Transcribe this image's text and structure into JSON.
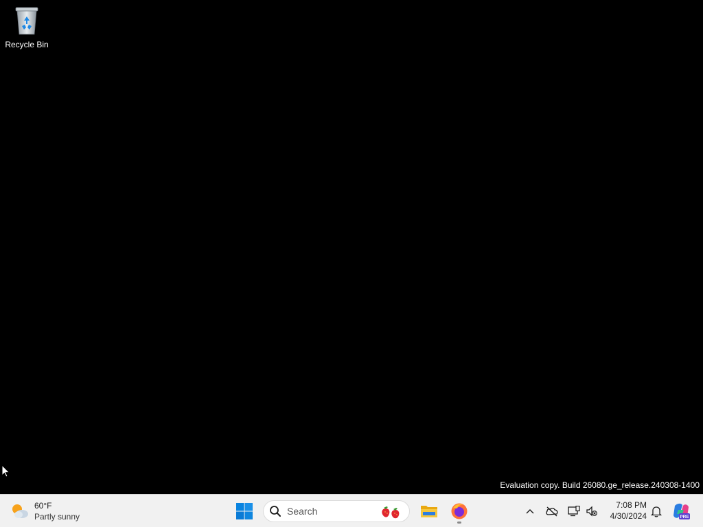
{
  "desktop": {
    "icons": [
      {
        "label": "Recycle Bin",
        "icon": "recycle-bin-icon"
      }
    ],
    "watermark": "Evaluation copy. Build 26080.ge_release.240308-1400",
    "background": "#000000"
  },
  "taskbar": {
    "weather": {
      "temp": "60°F",
      "condition": "Partly sunny",
      "icon": "partly-sunny-icon"
    },
    "start": {
      "icon": "windows-start-icon"
    },
    "search": {
      "placeholder": "Search",
      "icon": "search-icon",
      "decoration": "strawberry-icon"
    },
    "apps": [
      {
        "name": "File Explorer",
        "icon": "folder-icon",
        "running": false
      },
      {
        "name": "Firefox",
        "icon": "firefox-icon",
        "running": true
      }
    ],
    "tray": {
      "overflow_icon": "chevron-up-icon",
      "icons": [
        "cloud-offline-icon",
        "display-icon",
        "speaker-muted-icon"
      ]
    },
    "clock": {
      "time": "7:08 PM",
      "date": "4/30/2024"
    },
    "notifications_icon": "bell-icon",
    "copilot": {
      "icon": "copilot-icon",
      "badge": "PRE"
    }
  },
  "colors": {
    "taskbar_bg": "#f1f1f1",
    "start_blue": "#0078d4",
    "folder_yellow": "#f4c430"
  }
}
